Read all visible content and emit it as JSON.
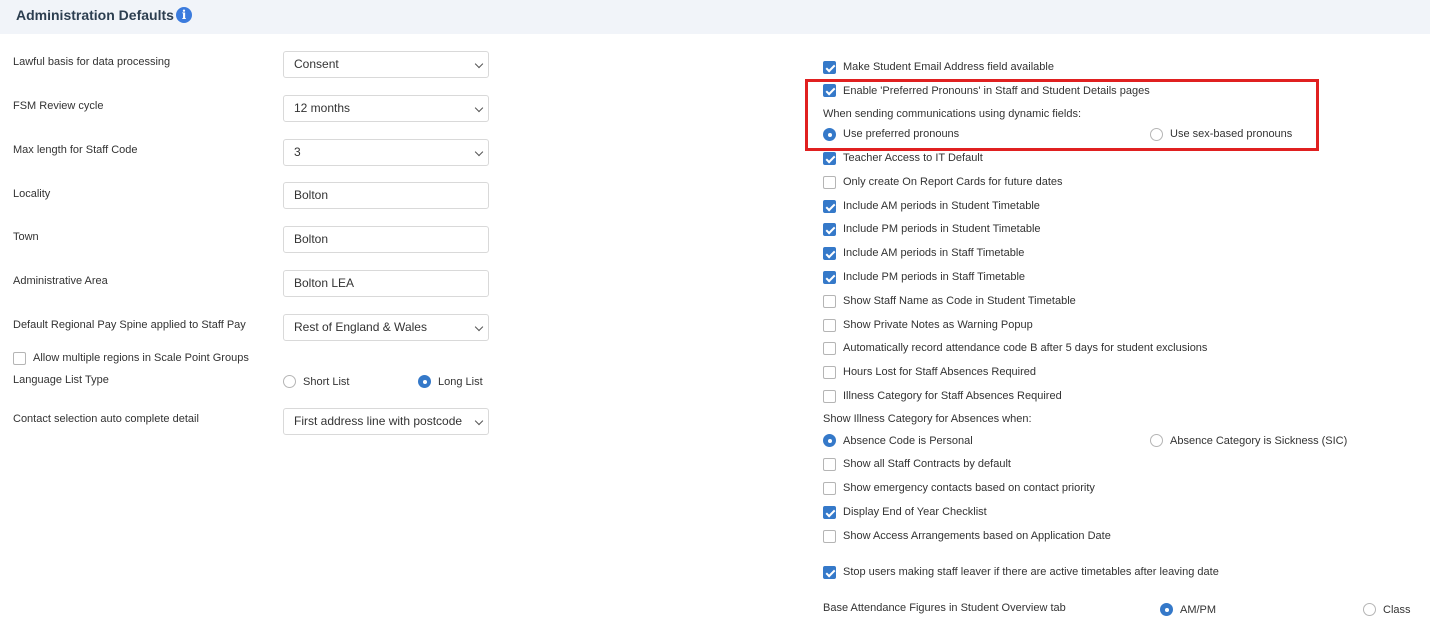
{
  "header": {
    "title": "Administration Defaults",
    "info_icon": "info-icon",
    "info_glyph": "i"
  },
  "left": {
    "lawful_basis": {
      "label": "Lawful basis for data processing",
      "value": "Consent"
    },
    "fsm_review": {
      "label": "FSM Review cycle",
      "value": "12 months"
    },
    "staff_code_max": {
      "label": "Max length for Staff Code",
      "value": "3"
    },
    "locality": {
      "label": "Locality",
      "value": "Bolton"
    },
    "town": {
      "label": "Town",
      "value": "Bolton"
    },
    "admin_area": {
      "label": "Administrative Area",
      "value": "Bolton LEA"
    },
    "pay_spine": {
      "label": "Default Regional Pay Spine applied to Staff Pay",
      "value": "Rest of England & Wales"
    },
    "multiple_regions": {
      "label": "Allow multiple regions in Scale Point Groups",
      "checked": false
    },
    "language_list": {
      "label": "Language List Type",
      "option_short": "Short List",
      "option_long": "Long List",
      "selected": "Long List"
    },
    "contact_autocomplete": {
      "label": "Contact selection auto complete detail",
      "value": "First address line with postcode"
    }
  },
  "right": {
    "items": [
      {
        "label": "Make Student Email Address field available",
        "checked": true
      },
      {
        "label": "Enable 'Preferred Pronouns' in Staff and Student Details pages",
        "checked": true
      },
      {
        "label": "Teacher Access to IT Default",
        "checked": true
      },
      {
        "label": "Only create On Report Cards for future dates",
        "checked": false
      },
      {
        "label": "Include AM periods in Student Timetable",
        "checked": true
      },
      {
        "label": "Include PM periods in Student Timetable",
        "checked": true
      },
      {
        "label": "Include AM periods in Staff Timetable",
        "checked": true
      },
      {
        "label": "Include PM periods in Staff Timetable",
        "checked": true
      },
      {
        "label": "Show Staff Name as Code in Student Timetable",
        "checked": false
      },
      {
        "label": "Show Private Notes as Warning Popup",
        "checked": false
      },
      {
        "label": "Automatically record attendance code B after 5 days for student exclusions",
        "checked": false
      },
      {
        "label": "Hours Lost for Staff Absences Required",
        "checked": false
      },
      {
        "label": "Illness Category for Staff Absences Required",
        "checked": false
      },
      {
        "label": "Show all Staff Contracts by default",
        "checked": false
      },
      {
        "label": "Show emergency contacts based on contact priority",
        "checked": false
      },
      {
        "label": "Display End of Year Checklist",
        "checked": true
      },
      {
        "label": "Show Access Arrangements based on Application Date",
        "checked": false
      },
      {
        "label": "Stop users making staff leaver if there are active timetables after leaving date",
        "checked": true
      }
    ],
    "pronouns": {
      "heading": "When sending communications using dynamic fields:",
      "option_preferred": "Use preferred pronouns",
      "option_sex": "Use sex-based pronouns",
      "selected": "Use preferred pronouns"
    },
    "illness_category": {
      "heading": "Show Illness Category for Absences when:",
      "option_personal": "Absence Code is Personal",
      "option_sickness": "Absence Category is Sickness (SIC)",
      "selected": "Absence Code is Personal"
    },
    "base_attendance": {
      "label": "Base Attendance Figures in Student Overview tab",
      "option_ampm": "AM/PM",
      "option_class": "Class",
      "selected": "AM/PM"
    }
  },
  "colors": {
    "accent": "#3579c9",
    "highlight": "#e02020",
    "header_bg": "#f1f4f9"
  }
}
